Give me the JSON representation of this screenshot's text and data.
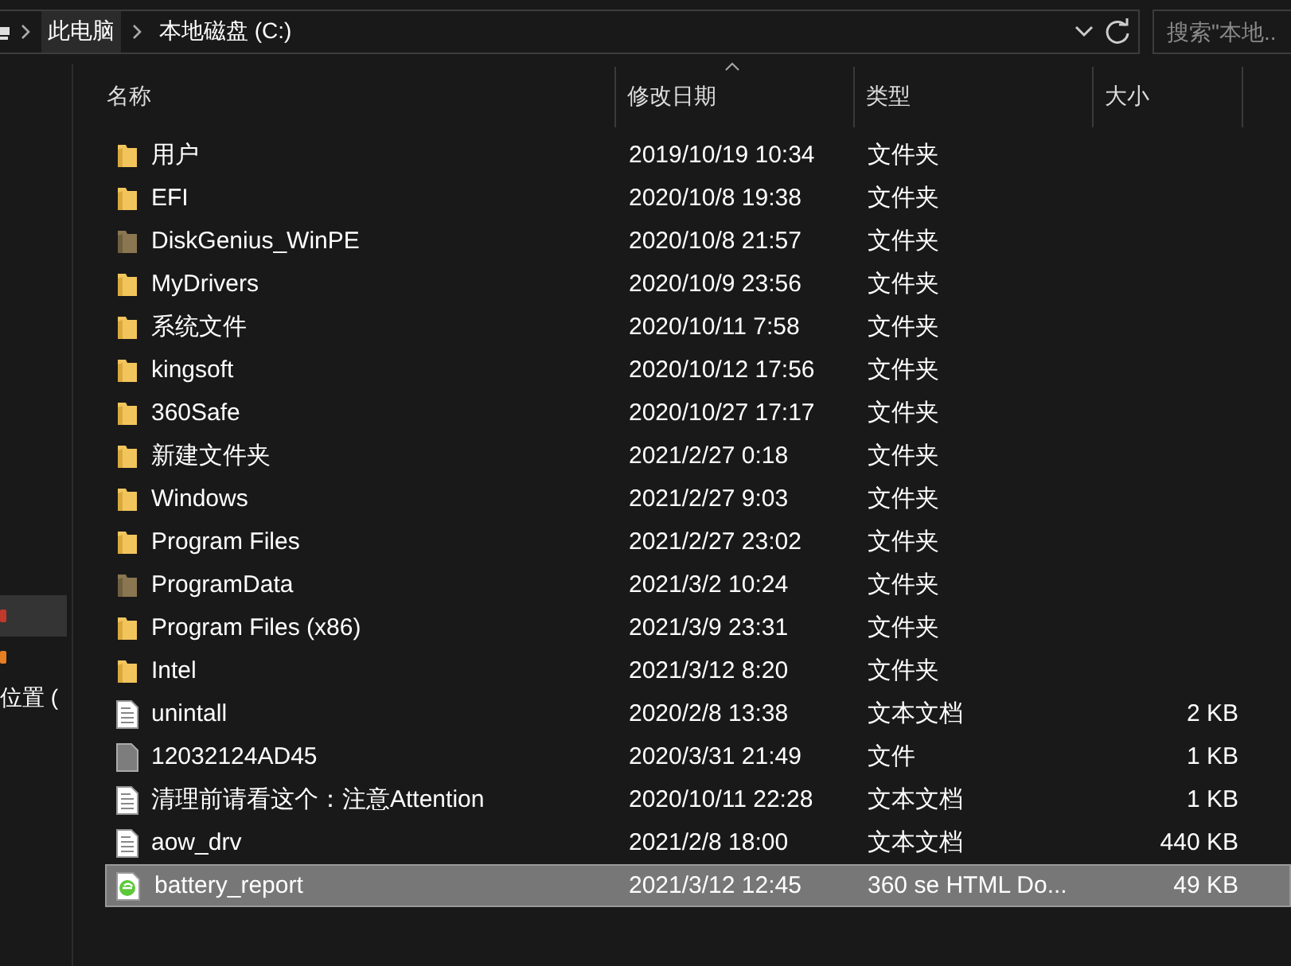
{
  "address_bar": {
    "crumbs": [
      {
        "label": "此电脑",
        "selected": true
      },
      {
        "label": "本地磁盘 (C:)",
        "selected": false
      }
    ]
  },
  "search": {
    "placeholder": "搜索\"本地..."
  },
  "nav_pane": {
    "items": [
      {
        "kind": "red",
        "selected": true
      },
      {
        "kind": "orange",
        "selected": false
      },
      {
        "label": "位置 (",
        "kind": "text",
        "selected": false
      }
    ]
  },
  "table": {
    "columns": [
      {
        "label": "名称",
        "sorted": false
      },
      {
        "label": "修改日期",
        "sorted": true
      },
      {
        "label": "类型",
        "sorted": false
      },
      {
        "label": "大小",
        "sorted": false
      }
    ],
    "rows": [
      {
        "name": "用户",
        "date": "2019/10/19 10:34",
        "type": "文件夹",
        "size": "",
        "kind": "folder",
        "hidden": false,
        "selected": false
      },
      {
        "name": "EFI",
        "date": "2020/10/8 19:38",
        "type": "文件夹",
        "size": "",
        "kind": "folder",
        "hidden": false,
        "selected": false
      },
      {
        "name": "DiskGenius_WinPE",
        "date": "2020/10/8 21:57",
        "type": "文件夹",
        "size": "",
        "kind": "folder",
        "hidden": true,
        "selected": false
      },
      {
        "name": "MyDrivers",
        "date": "2020/10/9 23:56",
        "type": "文件夹",
        "size": "",
        "kind": "folder",
        "hidden": false,
        "selected": false
      },
      {
        "name": "系统文件",
        "date": "2020/10/11 7:58",
        "type": "文件夹",
        "size": "",
        "kind": "folder",
        "hidden": false,
        "selected": false
      },
      {
        "name": "kingsoft",
        "date": "2020/10/12 17:56",
        "type": "文件夹",
        "size": "",
        "kind": "folder",
        "hidden": false,
        "selected": false
      },
      {
        "name": "360Safe",
        "date": "2020/10/27 17:17",
        "type": "文件夹",
        "size": "",
        "kind": "folder",
        "hidden": false,
        "selected": false
      },
      {
        "name": "新建文件夹",
        "date": "2021/2/27 0:18",
        "type": "文件夹",
        "size": "",
        "kind": "folder",
        "hidden": false,
        "selected": false
      },
      {
        "name": "Windows",
        "date": "2021/2/27 9:03",
        "type": "文件夹",
        "size": "",
        "kind": "folder",
        "hidden": false,
        "selected": false
      },
      {
        "name": "Program Files",
        "date": "2021/2/27 23:02",
        "type": "文件夹",
        "size": "",
        "kind": "folder",
        "hidden": false,
        "selected": false
      },
      {
        "name": "ProgramData",
        "date": "2021/3/2 10:24",
        "type": "文件夹",
        "size": "",
        "kind": "folder",
        "hidden": true,
        "selected": false
      },
      {
        "name": "Program Files (x86)",
        "date": "2021/3/9 23:31",
        "type": "文件夹",
        "size": "",
        "kind": "folder",
        "hidden": false,
        "selected": false
      },
      {
        "name": "Intel",
        "date": "2021/3/12 8:20",
        "type": "文件夹",
        "size": "",
        "kind": "folder",
        "hidden": false,
        "selected": false
      },
      {
        "name": "unintall",
        "date": "2020/2/8 13:38",
        "type": "文本文档",
        "size": "2 KB",
        "kind": "text",
        "hidden": false,
        "selected": false
      },
      {
        "name": "12032124AD45",
        "date": "2020/3/31 21:49",
        "type": "文件",
        "size": "1 KB",
        "kind": "file",
        "hidden": false,
        "selected": false
      },
      {
        "name": "清理前请看这个：注意Attention",
        "date": "2020/10/11 22:28",
        "type": "文本文档",
        "size": "1 KB",
        "kind": "text",
        "hidden": false,
        "selected": false
      },
      {
        "name": "aow_drv",
        "date": "2021/2/8 18:00",
        "type": "文本文档",
        "size": "440 KB",
        "kind": "text",
        "hidden": false,
        "selected": false
      },
      {
        "name": "battery_report",
        "date": "2021/3/12 12:45",
        "type": "360 se HTML Do...",
        "size": "49 KB",
        "kind": "html",
        "hidden": false,
        "selected": true
      }
    ]
  }
}
